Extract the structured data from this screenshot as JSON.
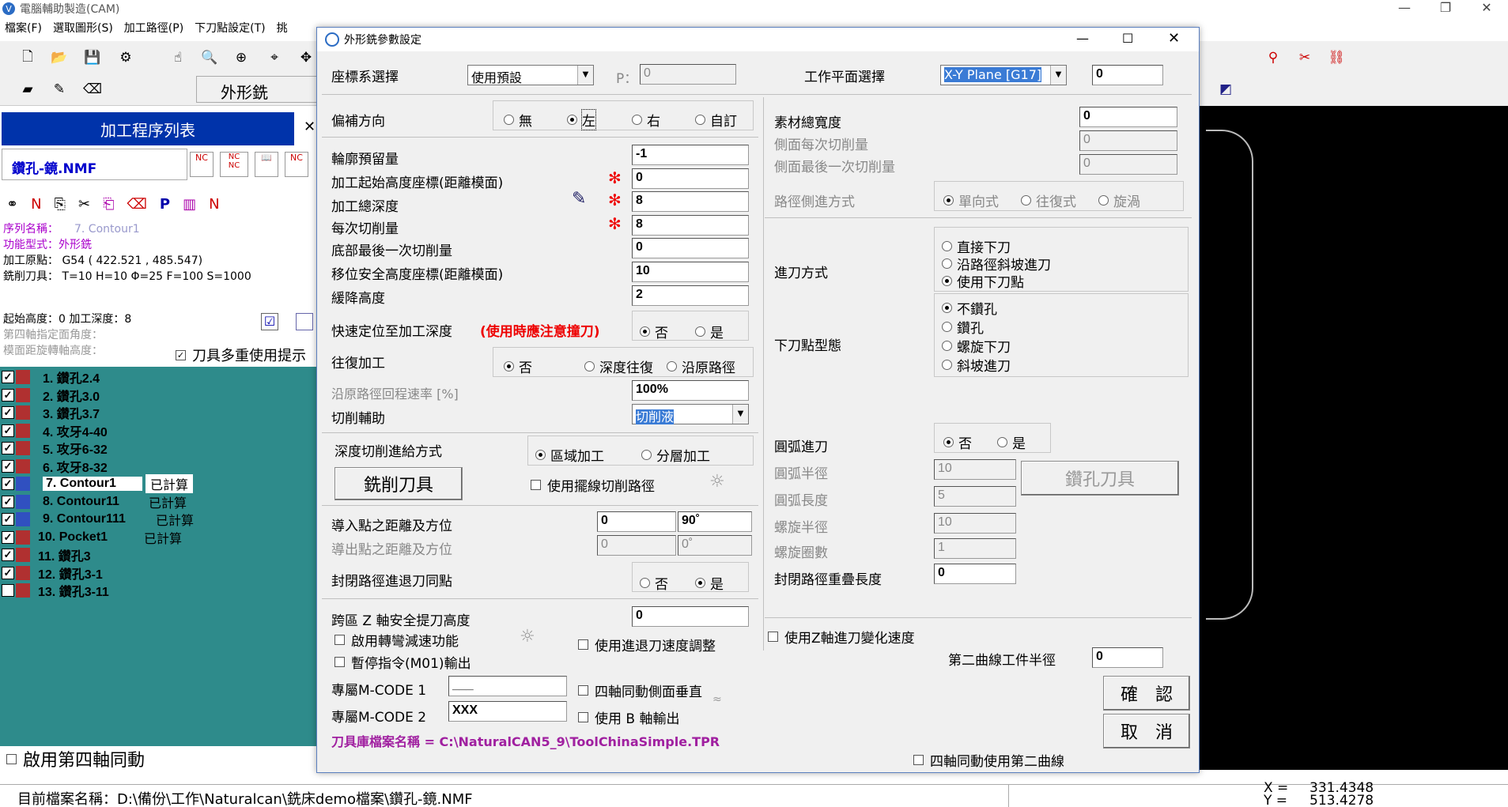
{
  "app": {
    "title": "電腦輔助製造(CAM)",
    "logo": "V"
  },
  "menu": [
    "檔案(F)",
    "選取圖形(S)",
    "加工路徑(P)",
    "下刀點設定(T)",
    "挑"
  ],
  "toolbar": {
    "mode_label": "外形銑"
  },
  "left": {
    "process_list_title": "加工程序列表",
    "file": "鑽孔-鏡.NMF",
    "seq_name_label": "序列名稱：",
    "seq_name_value": "7. Contour1",
    "func_type_label": "功能型式：",
    "func_type_value": "外形銑",
    "origin": "加工原點： G54 ( 422.521 , 485.547)",
    "tool": "銑削刀具： T=10 H=10 Φ=25 F=100 S=1000",
    "start_height": "起始高度：0 加工深度：8",
    "fourth_axis_angle": "第四軸指定面角度：",
    "mold_distance": "模面距旋轉軸高度：",
    "tool_reuse": "刀具多重使用提示",
    "tree": [
      {
        "label": "1. 鑽孔2.4",
        "status": "",
        "checked": true
      },
      {
        "label": "2. 鑽孔3.0",
        "status": "",
        "checked": true
      },
      {
        "label": "3. 鑽孔3.7",
        "status": "",
        "checked": true
      },
      {
        "label": "4. 攻牙4-40",
        "status": "",
        "checked": true
      },
      {
        "label": "5. 攻牙6-32",
        "status": "",
        "checked": true
      },
      {
        "label": "6. 攻牙8-32",
        "status": "",
        "checked": true
      },
      {
        "label": "7. Contour1",
        "status": "已計算",
        "checked": true
      },
      {
        "label": "8. Contour11",
        "status": "已計算",
        "checked": true
      },
      {
        "label": "9. Contour111",
        "status": "已計算",
        "checked": true
      },
      {
        "label": "10. Pocket1",
        "status": "已計算",
        "checked": true
      },
      {
        "label": "11. 鑽孔3",
        "status": "",
        "checked": true
      },
      {
        "label": "12. 鑽孔3-1",
        "status": "",
        "checked": true
      },
      {
        "label": "13. 鑽孔3-11",
        "status": "",
        "checked": false
      }
    ],
    "enable_4th_axis": "啟用第四軸同動"
  },
  "status": {
    "current_file": "目前檔案名稱：D:\\備份\\工作\\Naturalcan\\銑床demo檔案\\鑽孔-鏡.NMF",
    "x_label": "X =",
    "x_value": "331.4348",
    "y_label": "Y =",
    "y_value": "513.4278"
  },
  "dialog": {
    "title": "外形銑參數設定",
    "coord_label": "座標系選擇",
    "coord_value": "使用預設",
    "p_label": "P：",
    "p_value": "0",
    "plane_label": "工作平面選擇",
    "plane_value": "X-Y Plane [G17]",
    "plane_extra": "0",
    "offset_dir_label": "偏補方向",
    "offset_opts": [
      "無",
      "左",
      "右",
      "自訂"
    ],
    "profile_allowance_label": "輪廓預留量",
    "profile_allowance": "-1",
    "start_height_label": "加工起始高度座標(距離模面)",
    "start_height": "0",
    "total_depth_label": "加工總深度",
    "total_depth": "8",
    "step_label": "每次切削量",
    "step": "8",
    "bottom_last_label": "底部最後一次切削量",
    "bottom_last": "0",
    "safe_height_label": "移位安全高度座標(距離模面)",
    "safe_height": "10",
    "slow_down_label": "緩降高度",
    "slow_down": "2",
    "rapid_label": "快速定位至加工深度",
    "rapid_warn": "(使用時應注意撞刀)",
    "no": "否",
    "yes": "是",
    "recip_label": "往復加工",
    "recip_opts": [
      "否",
      "深度往復",
      "沿原路徑"
    ],
    "return_rate_label": "沿原路徑回程速率 [%]",
    "return_rate": "100%",
    "assist_label": "切削輔助",
    "assist_value": "切削液",
    "depth_feed_label": "深度切削進給方式",
    "depth_opts": [
      "區域加工",
      "分層加工"
    ],
    "mill_tool_btn": "銑削刀具",
    "swing_path": "使用擺線切削路徑",
    "lead_in_label": "導入點之距離及方位",
    "lead_in_d": "0",
    "lead_in_a": "90˚",
    "lead_out_label": "導出點之距離及方位",
    "lead_out_d": "0",
    "lead_out_a": "0˚",
    "closed_same_label": "封閉路徑進退刀同點",
    "cross_z_label": "跨區 Z 軸安全提刀高度",
    "cross_z": "0",
    "corner_slow": "啟用轉彎減速功能",
    "pause_m01": "暫停指令(M01)輸出",
    "use_inout_speed": "使用進退刀速度調整",
    "mcode1_label": "專屬M-CODE 1",
    "mcode1": "___",
    "mcode2_label": "專屬M-CODE 2",
    "mcode2": "XXX",
    "four_axis_perp": "四軸同動側面垂直",
    "use_b_axis": "使用 B 軸輸出",
    "tool_lib": "刀具庫檔案名稱 = C:\\NaturalCAN5_9\\ToolChinaSimple.TPR",
    "stock_width_label": "素材總寬度",
    "stock_width": "0",
    "side_step_label": "側面每次切削量",
    "side_step": "0",
    "side_last_label": "側面最後一次切削量",
    "side_last": "0",
    "side_feed_label": "路徑側進方式",
    "side_opts": [
      "單向式",
      "往復式",
      "旋渦"
    ],
    "entry_label": "進刀方式",
    "entry_opts": [
      "直接下刀",
      "沿路徑斜坡進刀",
      "使用下刀點"
    ],
    "plunge_label": "下刀點型態",
    "plunge_opts": [
      "不鑽孔",
      "鑽孔",
      "螺旋下刀",
      "斜坡進刀"
    ],
    "arc_label": "圓弧進刀",
    "arc_radius_label": "圓弧半徑",
    "arc_radius": "10",
    "arc_length_label": "圓弧長度",
    "arc_length": "5",
    "drill_tool_btn": "鑽孔刀具",
    "helix_radius_label": "螺旋半徑",
    "helix_radius": "10",
    "helix_turns_label": "螺旋圈數",
    "helix_turns": "1",
    "overlap_label": "封閉路徑重疊長度",
    "overlap": "0",
    "z_feed_var": "使用Z軸進刀變化速度",
    "second_curve_label": "第二曲線工件半徑",
    "second_curve": "0",
    "ok_btn": "確　認",
    "cancel_btn": "取　消",
    "four_axis_second": "四軸同動使用第二曲線"
  }
}
